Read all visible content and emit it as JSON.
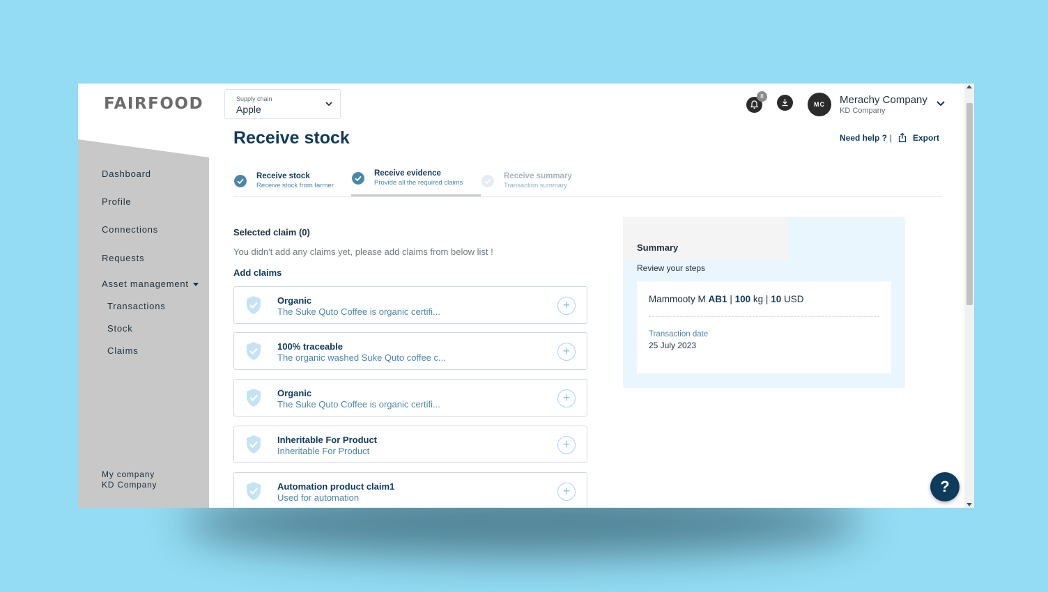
{
  "brand": {
    "logo_text": "FAIRFOOD"
  },
  "supply_chain": {
    "label": "Supply chain",
    "value": "Apple"
  },
  "header": {
    "notification_count": "8",
    "avatar_initials": "MC",
    "user_name": "Merachy Company",
    "user_company": "KD Company",
    "icons": [
      "bell-icon",
      "download-icon",
      "chevron-down-icon"
    ]
  },
  "sidebar": {
    "items": [
      {
        "label": "Dashboard"
      },
      {
        "label": "Profile"
      },
      {
        "label": "Connections"
      },
      {
        "label": "Requests"
      },
      {
        "label": "Asset management"
      }
    ],
    "sub_items": [
      {
        "label": "Transactions"
      },
      {
        "label": "Stock"
      },
      {
        "label": "Claims"
      }
    ],
    "my_company_label": "My company",
    "my_company_name": "KD Company"
  },
  "page": {
    "title": "Receive stock",
    "need_help": "Need help ?",
    "separator": "|",
    "export": "Export"
  },
  "steps": [
    {
      "title": "Receive stock",
      "subtitle": "Receive stock from farmer",
      "state": "done"
    },
    {
      "title": "Receive evidence",
      "subtitle": "Provide all the required claims",
      "state": "active"
    },
    {
      "title": "Receive summary",
      "subtitle": "Transaction summary",
      "state": "pending"
    }
  ],
  "claims": {
    "selected_title": "Selected claim (0)",
    "empty_message": "You didn't add any claims yet, please add claims from below list !",
    "add_title": "Add claims",
    "items": [
      {
        "title": "Organic",
        "description": "The Suke Quto Coffee is organic certifi..."
      },
      {
        "title": "100% traceable",
        "description": "The organic washed Suke Quto coffee c..."
      },
      {
        "title": "Organic",
        "description": "The Suke Quto Coffee is organic certifi..."
      },
      {
        "title": "Inheritable For Product",
        "description": "Inheritable For Product"
      },
      {
        "title": "Automation product claim1",
        "description": "Used for automation"
      }
    ]
  },
  "summary": {
    "title": "Summary",
    "subtitle": "Review your steps",
    "farmer": "Mammooty M",
    "batch": "AB1",
    "quantity": "100",
    "unit": "kg",
    "price": "10",
    "currency": "USD",
    "separator": "|",
    "date_label": "Transaction date",
    "date_value": "25 July 2023"
  },
  "help_button": "?",
  "colors": {
    "background": "#93dcf3",
    "primary": "#0e3a5b",
    "sidebar": "#c8c8c8",
    "accent_light": "#eaf6fd",
    "link_blue": "#4b86ab"
  }
}
